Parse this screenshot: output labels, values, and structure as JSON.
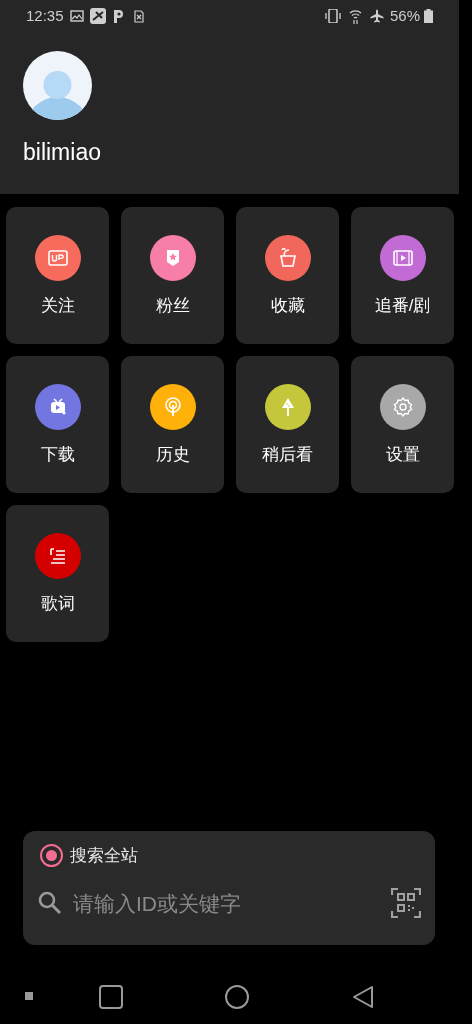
{
  "status_bar": {
    "time": "12:35",
    "battery": "56%"
  },
  "profile": {
    "name": "bilimiao"
  },
  "menu": [
    {
      "label": "关注",
      "kind": "up",
      "color": "#f76b5d"
    },
    {
      "label": "粉丝",
      "kind": "badge",
      "color": "#f77ea8"
    },
    {
      "label": "收藏",
      "kind": "bucket",
      "color": "#f2675c"
    },
    {
      "label": "追番/剧",
      "kind": "film",
      "color": "#c36bd5"
    },
    {
      "label": "下载",
      "kind": "tv",
      "color": "#7375e0"
    },
    {
      "label": "历史",
      "kind": "signal",
      "color": "#ffb10a"
    },
    {
      "label": "稍后看",
      "kind": "melon",
      "color": "#c4c63b"
    },
    {
      "label": "设置",
      "kind": "gear",
      "color": "#a8a8a8"
    },
    {
      "label": "歌词",
      "kind": "lyrics",
      "color": "#d40000"
    }
  ],
  "search": {
    "scope_label": "搜索全站",
    "scope_selected": true,
    "placeholder": "请输入ID或关键字"
  }
}
